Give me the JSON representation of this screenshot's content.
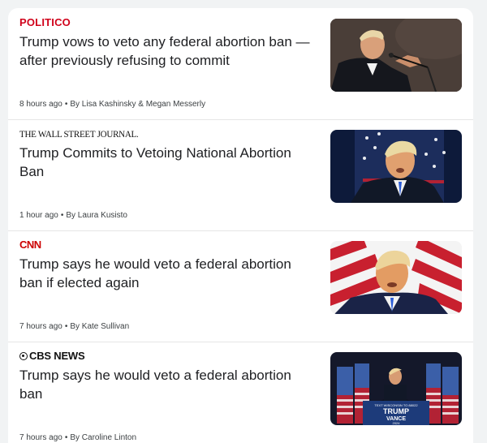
{
  "stories": [
    {
      "source": "POLITICO",
      "headline": "Trump vows to veto any federal abortion ban — after previously refusing to commit",
      "time": "8 hours ago",
      "byline": "By Lisa Kashinsky & Megan Messerly",
      "image": "trump-at-podium-photo"
    },
    {
      "source": "THE WALL STREET JOURNAL.",
      "headline": "Trump Commits to Vetoing National Abortion Ban",
      "time": "1 hour ago",
      "byline": "By Laura Kusisto",
      "image": "trump-portrait-flag-photo"
    },
    {
      "source": "CNN",
      "headline": "Trump says he would veto a federal abortion ban if elected again",
      "time": "7 hours ago",
      "byline": "By Kate Sullivan",
      "image": "trump-red-stripes-photo"
    },
    {
      "source": "CBS NEWS",
      "headline": "Trump says he would veto a federal abortion ban",
      "time": "7 hours ago",
      "byline": "By Caroline Linton",
      "image": "trump-rally-stage-photo",
      "image_sign": {
        "line1": "TEXT WISCONSIN TO 88022",
        "line2": "TRUMP",
        "line3": "VANCE",
        "line4": "2024"
      }
    }
  ],
  "colors": {
    "politico_red": "#d0021b",
    "cnn_red": "#cc0000",
    "headline": "#202124"
  }
}
